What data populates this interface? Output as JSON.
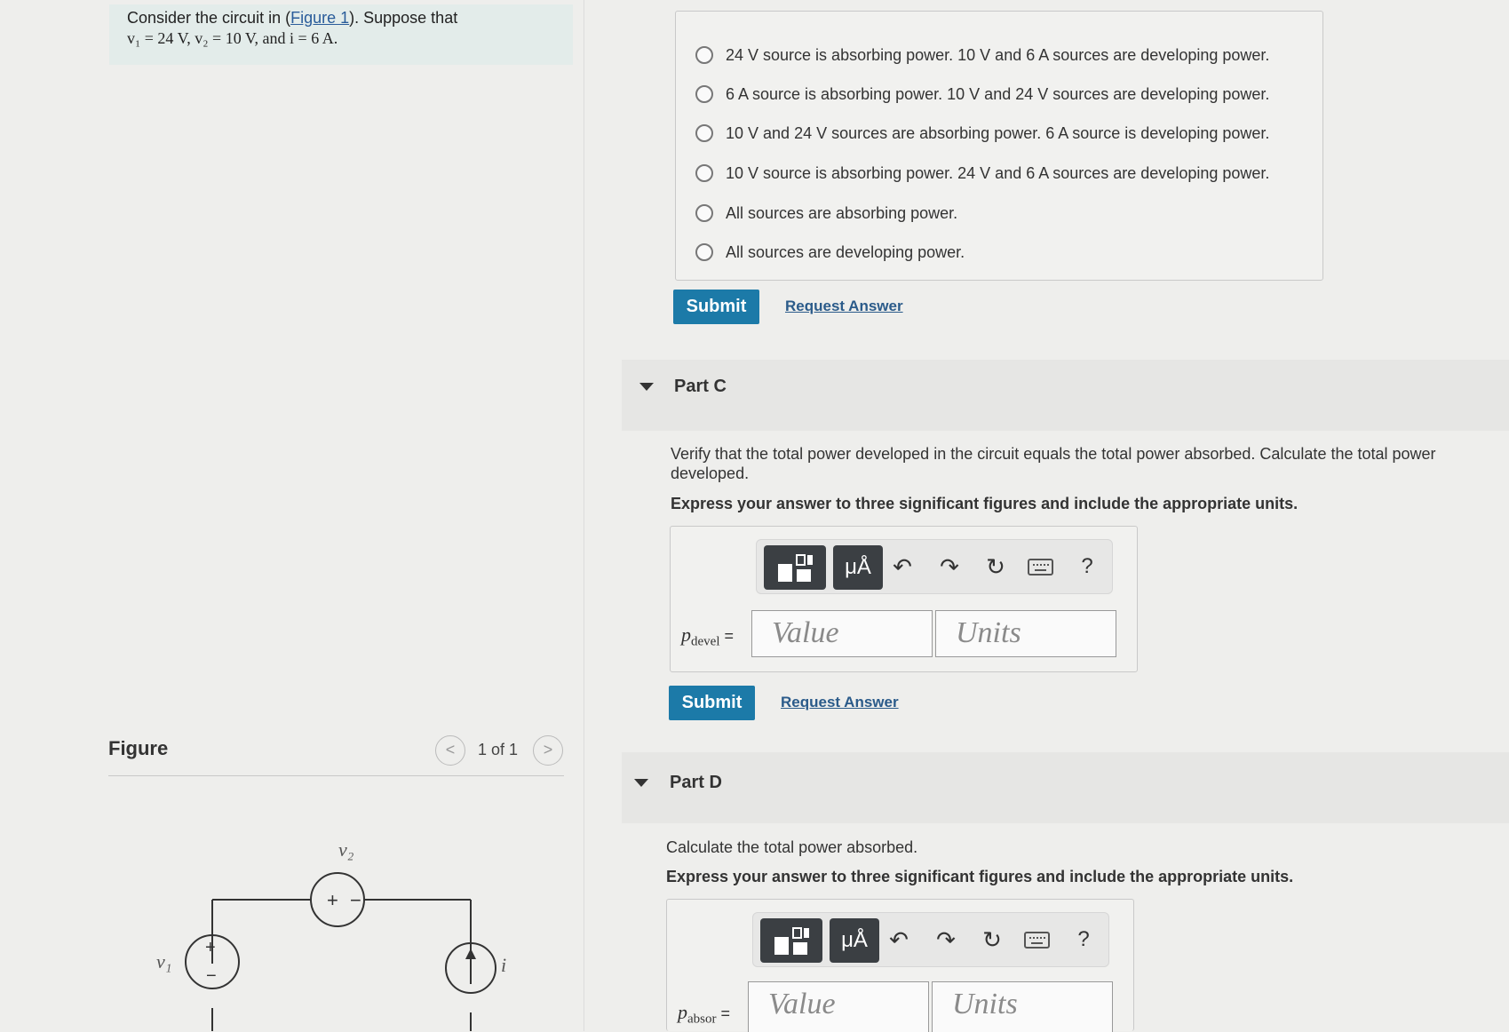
{
  "problem": {
    "intro_pre": "Consider the circuit in (",
    "figure_link": "Figure 1",
    "intro_post": "). Suppose that",
    "values_line": "v₁ = 24 V, v₂ = 10 V, and i = 6 A."
  },
  "figure": {
    "title": "Figure",
    "pager": "1 of 1",
    "prev": "<",
    "next": ">",
    "labels": {
      "v1": "v₁",
      "v2": "v₂",
      "i": "i",
      "plus": "+",
      "minus": "−"
    }
  },
  "part_b": {
    "options": [
      "24 V source is absorbing power. 10 V and 6 A sources are developing power.",
      "6 A source is absorbing power. 10 V and 24 V sources are developing power.",
      "10 V and 24 V sources are absorbing power. 6 A source is developing power.",
      "10 V source is absorbing power. 24 V and 6 A sources are developing power.",
      "All sources are absorbing power.",
      "All sources are developing power."
    ],
    "submit": "Submit",
    "request": "Request Answer"
  },
  "part_c": {
    "label": "Part C",
    "prompt": "Verify that the total power developed in the circuit equals the total power absorbed. Calculate the total power developed.",
    "instruction": "Express your answer to three significant figures and include the appropriate units.",
    "var": "p",
    "var_sub": "devel",
    "value_placeholder": "Value",
    "units_placeholder": "Units",
    "submit": "Submit",
    "request": "Request Answer"
  },
  "part_d": {
    "label": "Part D",
    "prompt": "Calculate the total power absorbed.",
    "instruction": "Express your answer to three significant figures and include the appropriate units.",
    "var": "p",
    "var_sub": "absor",
    "value_placeholder": "Value",
    "units_placeholder": "Units"
  },
  "toolbar": {
    "units_btn": "μÅ",
    "undo": "↶",
    "redo": "↷",
    "reset": "↻",
    "help": "?"
  }
}
